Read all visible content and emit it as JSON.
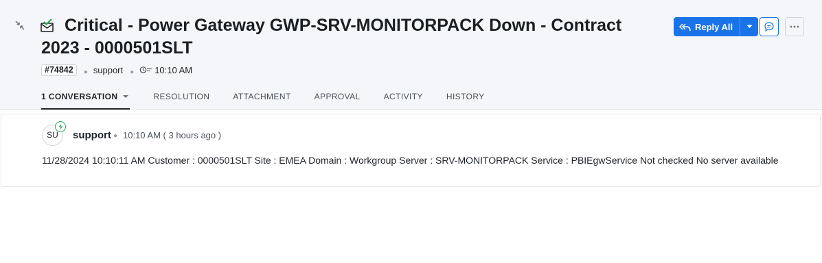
{
  "ticket": {
    "title": "Critical - Power Gateway GWP-SRV-MONITORPACK Down - Contract 2023 - 0000501SLT",
    "id": "#74842",
    "requester": "support",
    "time": "10:10 AM"
  },
  "actions": {
    "reply_all_label": "Reply All"
  },
  "tabs": [
    {
      "label": "1 CONVERSATION",
      "active": true
    },
    {
      "label": "RESOLUTION"
    },
    {
      "label": "ATTACHMENT"
    },
    {
      "label": "APPROVAL"
    },
    {
      "label": "ACTIVITY"
    },
    {
      "label": "HISTORY"
    }
  ],
  "conversation": {
    "avatar_initials": "SU",
    "author": "support",
    "time": "10:10 AM ( 3 hours ago )",
    "body": "11/28/2024 10:10:11 AM Customer : 0000501SLT Site : EMEA Domain : Workgroup Server : SRV-MONITORPACK Service : PBIEgwService Not checked No server available"
  },
  "colors": {
    "accent": "#1a73e8",
    "header_bg": "#f5f6f9",
    "badge_green": "#2aa65a"
  },
  "icons": {
    "collapse": "collapse-arrows-icon",
    "mail": "mail-check-icon",
    "clock": "clock-icon",
    "reply": "reply-all-icon",
    "dropdown": "chevron-down-icon",
    "chat": "chat-bubble-icon",
    "more": "more-horizontal-icon",
    "bolt": "lightning-icon"
  }
}
